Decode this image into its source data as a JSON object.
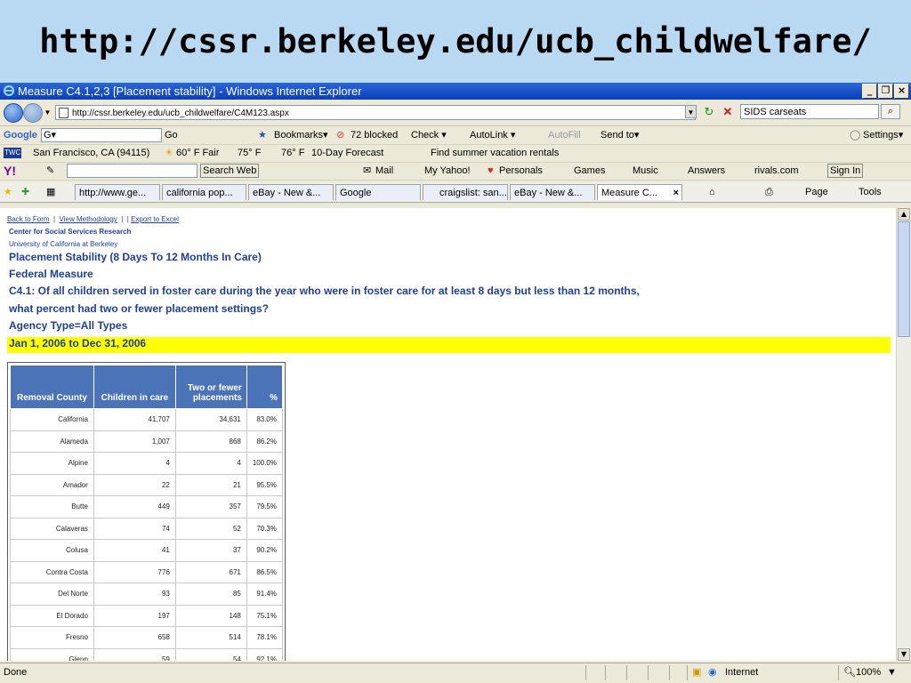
{
  "slide": {
    "title": "http://cssr.berkeley.edu/ucb_childwelfare/"
  },
  "window": {
    "title": "Measure C4.1,2,3 [Placement stability] - Windows Internet Explorer",
    "buttons": [
      "_",
      "❐",
      "×"
    ]
  },
  "address": {
    "url": "http://cssr.berkeley.edu/ucb_childwelfare/C4M123.aspx",
    "search_value": "SIDS carseats"
  },
  "google_bar": {
    "logo": "Google",
    "input_value": "G▾",
    "go": "Go",
    "bookmarks": "Bookmarks▾",
    "blocked": "72 blocked",
    "check": "Check ▾",
    "autolink": "AutoLink ▾",
    "autofill": "AutoFill",
    "sendto": "Send to▾",
    "settings": "Settings▾"
  },
  "weather_bar": {
    "location": "San Francisco, CA (94115)",
    "fair": "60° F Fair",
    "temp1": "75° F",
    "temp2": "76° F",
    "forecast": "10-Day Forecast",
    "find": "Find summer vacation rentals"
  },
  "yahoo_bar": {
    "logo": "Y!",
    "search_web": "Search Web",
    "mail": "Mail",
    "my_yahoo": "My Yahoo!",
    "personals": "Personals",
    "games": "Games",
    "music": "Music",
    "answers": "Answers",
    "rivals": "rivals.com",
    "sign_in": "Sign In"
  },
  "tabs": [
    {
      "label": "http://www.ge..."
    },
    {
      "label": "california pop..."
    },
    {
      "label": "eBay - New &..."
    },
    {
      "label": "Google"
    },
    {
      "label": "craigslist: san..."
    },
    {
      "label": "eBay - New &..."
    },
    {
      "label": "Measure C..."
    }
  ],
  "tab_tools": {
    "page": "Page",
    "tools": "Tools"
  },
  "page": {
    "link_back": "Back to Form",
    "link_methodology": "View Methodology",
    "link_export": "Export to Excel",
    "org1": "Center for Social Services Research",
    "org2": "University of California at Berkeley",
    "heading1": "Placement Stability (8 Days To 12 Months In Care)",
    "heading2": "Federal Measure",
    "heading3": "C4.1: Of all children served in foster care during the year who were in foster care for at least 8 days but less than 12 months,",
    "heading4": "what percent had two or fewer placement settings?",
    "heading5": "Agency Type=All Types",
    "date_range": "Jan 1, 2006 to Dec 31, 2006"
  },
  "table": {
    "headers": [
      "Removal County",
      "Children in care",
      "Two or fewer placements",
      "%"
    ],
    "rows": [
      [
        "California",
        "41,707",
        "34,631",
        "83.0%"
      ],
      [
        "Alameda",
        "1,007",
        "868",
        "86.2%"
      ],
      [
        "Alpine",
        "4",
        "4",
        "100.0%"
      ],
      [
        "Amador",
        "22",
        "21",
        "95.5%"
      ],
      [
        "Butte",
        "449",
        "357",
        "79.5%"
      ],
      [
        "Calaveras",
        "74",
        "52",
        "70.3%"
      ],
      [
        "Colusa",
        "41",
        "37",
        "90.2%"
      ],
      [
        "Contra Costa",
        "776",
        "671",
        "86.5%"
      ],
      [
        "Del Norte",
        "93",
        "85",
        "91.4%"
      ],
      [
        "El Dorado",
        "197",
        "148",
        "75.1%"
      ],
      [
        "Fresno",
        "658",
        "514",
        "78.1%"
      ],
      [
        "Glenn",
        "59",
        "54",
        "92.1%"
      ]
    ]
  },
  "status": {
    "text": "Done",
    "zone": "Internet",
    "zoom": "100%"
  },
  "colors": {
    "slide_bg": "#b9d8f2",
    "header_blue": "#4b73b7",
    "text_blue": "#1f3f99",
    "highlight": "#ffff00"
  }
}
